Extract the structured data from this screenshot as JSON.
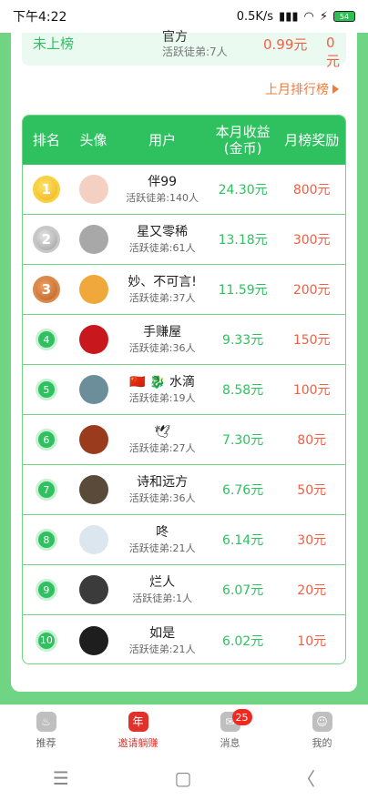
{
  "statusbar": {
    "time": "下午4:22",
    "speed": "0.5K/s",
    "battery": "54"
  },
  "my_rank": {
    "status": "未上榜",
    "name": "官方",
    "active_apprentices": "活跃徒弟:7人",
    "income": "0.99元",
    "reward": "0元"
  },
  "last_month_link": "上月排行榜",
  "table": {
    "headers": [
      "排名",
      "头像",
      "用户",
      "本月收益\n(金币)",
      "月榜奖励"
    ],
    "rows": [
      {
        "rank": "1",
        "name": "伴99",
        "apprentices": "活跃徒弟:140人",
        "income": "24.30元",
        "reward": "800元",
        "avatar_color": "#f3d0c1"
      },
      {
        "rank": "2",
        "name": "星又零稀",
        "apprentices": "活跃徒弟:61人",
        "income": "13.18元",
        "reward": "300元",
        "avatar_color": "#a8a8a8"
      },
      {
        "rank": "3",
        "name": "妙、不可言!",
        "apprentices": "活跃徒弟:37人",
        "income": "11.59元",
        "reward": "200元",
        "avatar_color": "#f0a83a"
      },
      {
        "rank": "4",
        "name": "手赚屋",
        "apprentices": "活跃徒弟:36人",
        "income": "9.33元",
        "reward": "150元",
        "avatar_color": "#c8171d"
      },
      {
        "rank": "5",
        "name": "🇨🇳 🐉 水滴",
        "apprentices": "活跃徒弟:19人",
        "income": "8.58元",
        "reward": "100元",
        "avatar_color": "#6b8e9a"
      },
      {
        "rank": "6",
        "name": "🕊",
        "apprentices": "活跃徒弟:27人",
        "income": "7.30元",
        "reward": "80元",
        "avatar_color": "#9a3b1d"
      },
      {
        "rank": "7",
        "name": "诗和远方",
        "apprentices": "活跃徒弟:36人",
        "income": "6.76元",
        "reward": "50元",
        "avatar_color": "#5a4a3a"
      },
      {
        "rank": "8",
        "name": "咚",
        "apprentices": "活跃徒弟:21人",
        "income": "6.14元",
        "reward": "30元",
        "avatar_color": "#dbe6ef"
      },
      {
        "rank": "9",
        "name": "烂人",
        "apprentices": "活跃徒弟:1人",
        "income": "6.07元",
        "reward": "20元",
        "avatar_color": "#3b3b3b"
      },
      {
        "rank": "10",
        "name": "如是",
        "apprentices": "活跃徒弟:21人",
        "income": "6.02元",
        "reward": "10元",
        "avatar_color": "#1e1e1e"
      }
    ]
  },
  "tabbar": {
    "tabs": [
      {
        "label": "推荐",
        "icon": "fire-icon"
      },
      {
        "label": "邀请躺赚",
        "icon": "invite-icon",
        "glyph": "年"
      },
      {
        "label": "消息",
        "icon": "message-icon",
        "badge": "25"
      },
      {
        "label": "我的",
        "icon": "profile-icon"
      }
    ]
  },
  "navbar": {
    "menu": "☰",
    "home": "▢",
    "back": "〈"
  },
  "colors": {
    "primary": "#2fc160",
    "accent": "#f06044",
    "link": "#f47b3a",
    "tab_active": "#e2312a"
  }
}
